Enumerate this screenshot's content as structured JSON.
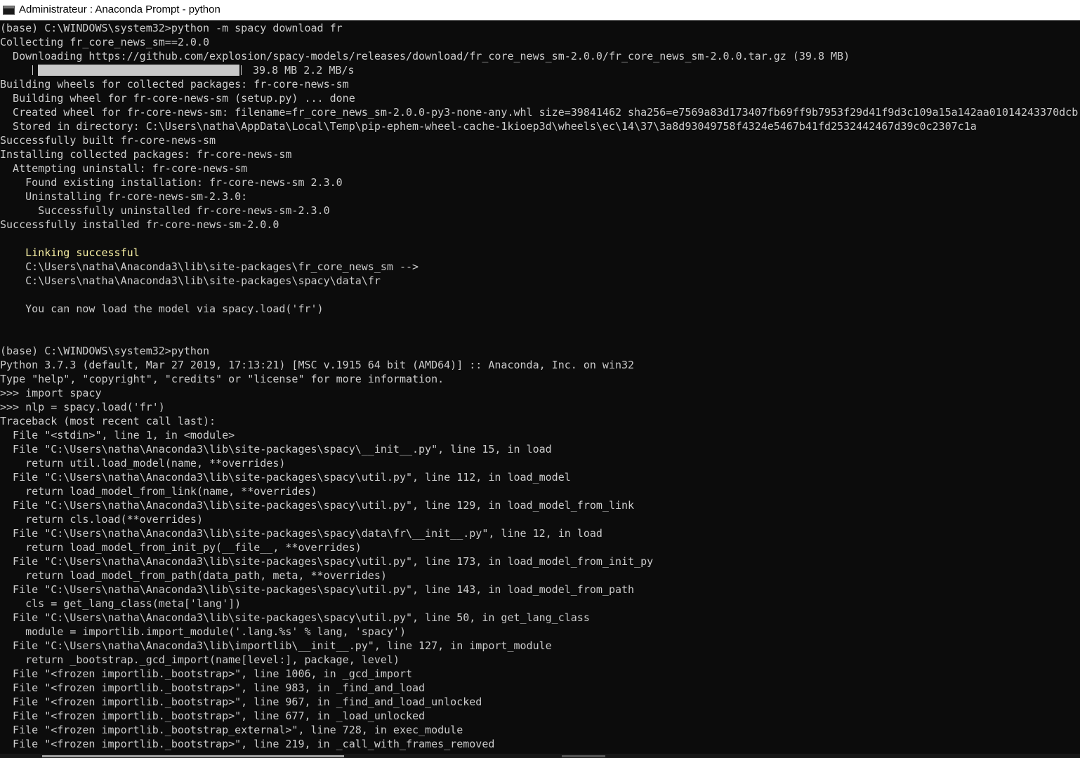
{
  "window": {
    "title": "Administrateur : Anaconda Prompt - python",
    "icon": "console-icon"
  },
  "download_progress": {
    "fraction": 1.0,
    "text": "39.8 MB 2.2 MB/s"
  },
  "lines": [
    {
      "text": "(base) C:\\WINDOWS\\system32>python -m spacy download fr"
    },
    {
      "text": "Collecting fr_core_news_sm==2.0.0"
    },
    {
      "text": "  Downloading https://github.com/explosion/spacy-models/releases/download/fr_core_news_sm-2.0.0/fr_core_news_sm-2.0.0.tar.gz (39.8 MB)"
    },
    {
      "text": ""
    },
    {
      "text": "Building wheels for collected packages: fr-core-news-sm"
    },
    {
      "text": "  Building wheel for fr-core-news-sm (setup.py) ... done"
    },
    {
      "text": "  Created wheel for fr-core-news-sm: filename=fr_core_news_sm-2.0.0-py3-none-any.whl size=39841462 sha256=e7569a83d173407fb69ff9b7953f29d41f9d3c109a15a142aa01014243370dcb"
    },
    {
      "text": "  Stored in directory: C:\\Users\\natha\\AppData\\Local\\Temp\\pip-ephem-wheel-cache-1kioep3d\\wheels\\ec\\14\\37\\3a8d93049758f4324e5467b41fd2532442467d39c0c2307c1a"
    },
    {
      "text": "Successfully built fr-core-news-sm"
    },
    {
      "text": "Installing collected packages: fr-core-news-sm"
    },
    {
      "text": "  Attempting uninstall: fr-core-news-sm"
    },
    {
      "text": "    Found existing installation: fr-core-news-sm 2.3.0"
    },
    {
      "text": "    Uninstalling fr-core-news-sm-2.3.0:"
    },
    {
      "text": "      Successfully uninstalled fr-core-news-sm-2.3.0"
    },
    {
      "text": "Successfully installed fr-core-news-sm-2.0.0"
    },
    {
      "text": ""
    },
    {
      "text": "    Linking successful",
      "color": "#f9f1a5"
    },
    {
      "text": "    C:\\Users\\natha\\Anaconda3\\lib\\site-packages\\fr_core_news_sm -->"
    },
    {
      "text": "    C:\\Users\\natha\\Anaconda3\\lib\\site-packages\\spacy\\data\\fr"
    },
    {
      "text": ""
    },
    {
      "text": "    You can now load the model via spacy.load('fr')"
    },
    {
      "text": ""
    },
    {
      "text": ""
    },
    {
      "text": "(base) C:\\WINDOWS\\system32>python"
    },
    {
      "text": "Python 3.7.3 (default, Mar 27 2019, 17:13:21) [MSC v.1915 64 bit (AMD64)] :: Anaconda, Inc. on win32"
    },
    {
      "text": "Type \"help\", \"copyright\", \"credits\" or \"license\" for more information."
    },
    {
      "text": ">>> import spacy"
    },
    {
      "text": ">>> nlp = spacy.load('fr')"
    },
    {
      "text": "Traceback (most recent call last):"
    },
    {
      "text": "  File \"<stdin>\", line 1, in <module>"
    },
    {
      "text": "  File \"C:\\Users\\natha\\Anaconda3\\lib\\site-packages\\spacy\\__init__.py\", line 15, in load"
    },
    {
      "text": "    return util.load_model(name, **overrides)"
    },
    {
      "text": "  File \"C:\\Users\\natha\\Anaconda3\\lib\\site-packages\\spacy\\util.py\", line 112, in load_model"
    },
    {
      "text": "    return load_model_from_link(name, **overrides)"
    },
    {
      "text": "  File \"C:\\Users\\natha\\Anaconda3\\lib\\site-packages\\spacy\\util.py\", line 129, in load_model_from_link"
    },
    {
      "text": "    return cls.load(**overrides)"
    },
    {
      "text": "  File \"C:\\Users\\natha\\Anaconda3\\lib\\site-packages\\spacy\\data\\fr\\__init__.py\", line 12, in load"
    },
    {
      "text": "    return load_model_from_init_py(__file__, **overrides)"
    },
    {
      "text": "  File \"C:\\Users\\natha\\Anaconda3\\lib\\site-packages\\spacy\\util.py\", line 173, in load_model_from_init_py"
    },
    {
      "text": "    return load_model_from_path(data_path, meta, **overrides)"
    },
    {
      "text": "  File \"C:\\Users\\natha\\Anaconda3\\lib\\site-packages\\spacy\\util.py\", line 143, in load_model_from_path"
    },
    {
      "text": "    cls = get_lang_class(meta['lang'])"
    },
    {
      "text": "  File \"C:\\Users\\natha\\Anaconda3\\lib\\site-packages\\spacy\\util.py\", line 50, in get_lang_class"
    },
    {
      "text": "    module = importlib.import_module('.lang.%s' % lang, 'spacy')"
    },
    {
      "text": "  File \"C:\\Users\\natha\\Anaconda3\\lib\\importlib\\__init__.py\", line 127, in import_module"
    },
    {
      "text": "    return _bootstrap._gcd_import(name[level:], package, level)"
    },
    {
      "text": "  File \"<frozen importlib._bootstrap>\", line 1006, in _gcd_import"
    },
    {
      "text": "  File \"<frozen importlib._bootstrap>\", line 983, in _find_and_load"
    },
    {
      "text": "  File \"<frozen importlib._bootstrap>\", line 967, in _find_and_load_unlocked"
    },
    {
      "text": "  File \"<frozen importlib._bootstrap>\", line 677, in _load_unlocked"
    },
    {
      "text": "  File \"<frozen importlib._bootstrap_external>\", line 728, in exec_module"
    },
    {
      "text": "  File \"<frozen importlib._bootstrap>\", line 219, in _call_with_frames_removed"
    }
  ]
}
